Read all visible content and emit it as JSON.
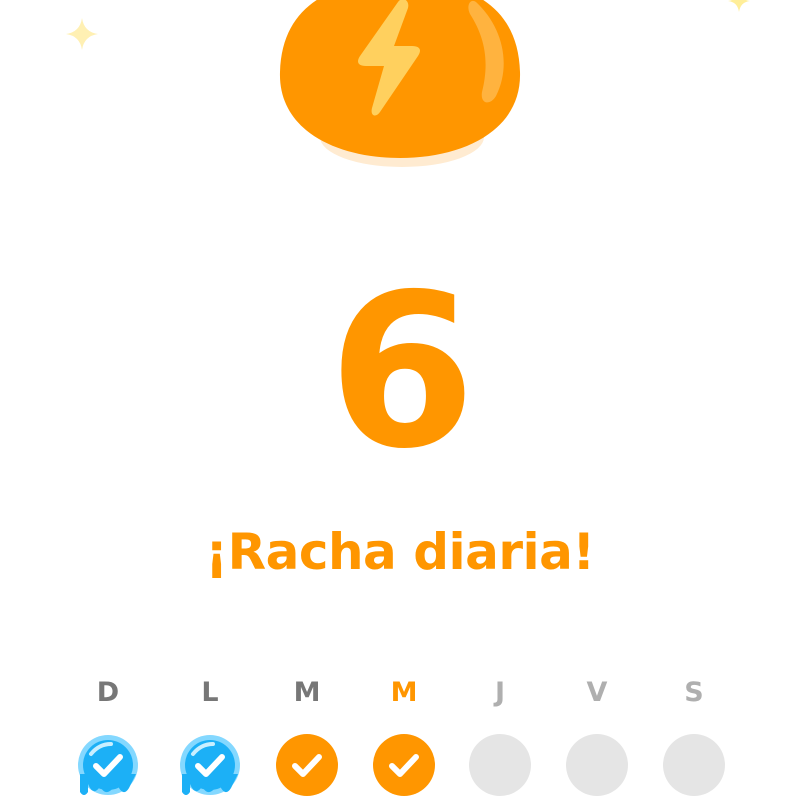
{
  "streak": {
    "count": "6",
    "title": "¡Racha diaria!",
    "icon": "lightning-bolt-icon"
  },
  "colors": {
    "accent": "#FF9600",
    "frozen": "#1CB0F6",
    "empty": "#E5E5E5",
    "label_done": "#777777",
    "label_future": "#AFAFAF"
  },
  "week": {
    "days": [
      {
        "label": "D",
        "status": "frozen"
      },
      {
        "label": "L",
        "status": "frozen"
      },
      {
        "label": "M",
        "status": "completed"
      },
      {
        "label": "M",
        "status": "today"
      },
      {
        "label": "J",
        "status": "pending"
      },
      {
        "label": "V",
        "status": "pending"
      },
      {
        "label": "S",
        "status": "pending"
      }
    ]
  }
}
